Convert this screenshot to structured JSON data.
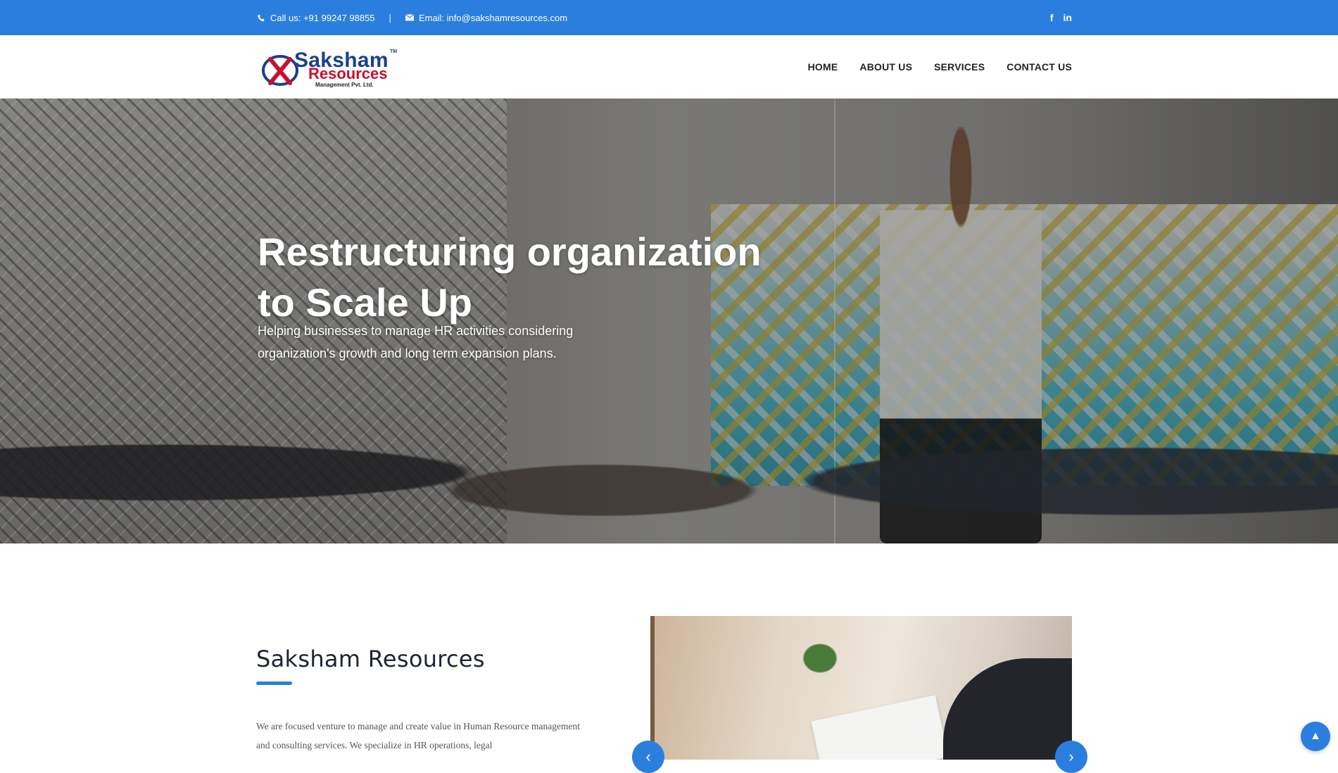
{
  "topbar": {
    "phone": "Call us: +91 99247 98855",
    "phone_icon": "phone-icon",
    "separator": "|",
    "email": "Email: info@sakshamresources.com",
    "email_icon": "envelope-icon",
    "social": [
      "f",
      "in"
    ]
  },
  "logo": {
    "line1": "Saksham",
    "line2": "Resources",
    "line3": "Management Pvt. Ltd.",
    "tm": "TM"
  },
  "nav": {
    "items": [
      "HOME",
      "ABOUT US",
      "SERVICES",
      "CONTACT US"
    ]
  },
  "hero": {
    "title": "Restructuring organization to Scale Up",
    "subtitle": "Helping businesses to manage HR activities considering organization's growth and long term expansion plans."
  },
  "about": {
    "title": "Saksham Resources",
    "text": "We are focused venture to manage and create value in Human Resource management and consulting services. We specialize in HR operations, legal"
  },
  "slider": {
    "prev": "‹",
    "next": "›"
  },
  "scroll_top": "▲",
  "colors": {
    "accent": "#2a7fde",
    "brand_blue": "#1d3f8c",
    "brand_red": "#c8102e"
  }
}
